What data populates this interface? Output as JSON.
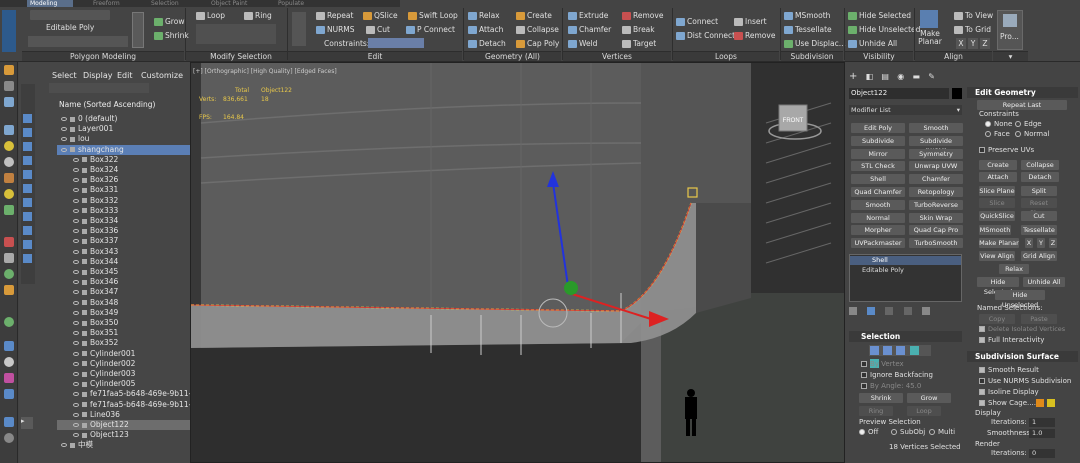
{
  "ribbon": {
    "tabs": [
      "Modeling",
      "Freeform",
      "Selection",
      "Object Paint",
      "Populate"
    ],
    "poly_label": "Editable Poly",
    "groups": [
      "Polygon Modeling",
      "Modify Selection",
      "Edit",
      "Geometry (All)",
      "Vertices",
      "Loops",
      "Subdivision",
      "Visibility",
      "Align"
    ],
    "modsel": [
      "Grow",
      "Shrink",
      "Loop",
      "Ring"
    ],
    "edit": [
      "Repeat",
      "QSlice",
      "Swift Loop",
      "NURMS",
      "Cut",
      "P Connect",
      "Constraints:"
    ],
    "geom": [
      "Relax",
      "Create",
      "Attach",
      "Collapse",
      "Detach",
      "Cap Poly"
    ],
    "verts": [
      "Extrude",
      "Remove",
      "Chamfer",
      "Break",
      "Weld",
      "Target"
    ],
    "loops": [
      "Connect",
      "Insert",
      "Dist Connect",
      "Remove"
    ],
    "subdiv": [
      "MSmooth",
      "Tessellate",
      "Use Displac..."
    ],
    "vis": [
      "Hide Selected",
      "Hide Unselected",
      "Unhide All"
    ],
    "align": [
      "Make Planar",
      "To View",
      "To Grid",
      "X",
      "Y",
      "Z"
    ],
    "pro": "Pro..."
  },
  "scene": {
    "menu": [
      "Select",
      "Display",
      "Edit",
      "Customize"
    ],
    "sort_label": "Name (Sorted Ascending)",
    "items": [
      "0 (default)",
      "Layer001",
      "lou",
      "shangchang",
      "Box322",
      "Box324",
      "Box326",
      "Box331",
      "Box332",
      "Box333",
      "Box334",
      "Box336",
      "Box337",
      "Box343",
      "Box344",
      "Box345",
      "Box346",
      "Box347",
      "Box348",
      "Box349",
      "Box350",
      "Box351",
      "Box352",
      "Cylinder001",
      "Cylinder002",
      "Cylinder003",
      "Cylinder005",
      "fe71faa5-b648-469e-9b11-f1",
      "fe71faa5-b648-469e-9b11-f1",
      "Line036",
      "Object122",
      "Object123",
      "中模"
    ]
  },
  "viewport": {
    "label": "[+] [Orthographic] [High Quality] [Edged Faces]",
    "stats_total": "Total",
    "stats_obj": "Object122",
    "verts_label": "Verts:",
    "verts_total": "836,661",
    "verts_obj": "18",
    "fps_label": "FPS:",
    "fps_val": "164.84",
    "viewcube": "FRONT"
  },
  "cmd": {
    "object_name": "Object122",
    "modifier_list": "Modifier List",
    "mod_buttons": [
      "Edit Poly",
      "Smooth",
      "Subdivide",
      "Subdivide (WSM)",
      "Mirror",
      "Symmetry",
      "STL Check",
      "Unwrap UVW",
      "Shell",
      "Chamfer",
      "Quad Chamfer",
      "Retopology",
      "Smooth",
      "TurboReverse",
      "Normal",
      "Skin Wrap",
      "Morpher",
      "Quad Cap Pro",
      "UVPackmaster",
      "TurboSmooth"
    ],
    "stack": [
      "Shell",
      "Editable Poly"
    ],
    "selection_title": "Selection",
    "by_vertex": "By Vertex",
    "ignore_backfacing": "Ignore Backfacing",
    "by_angle": "By Angle:",
    "by_angle_val": "45.0",
    "shrink": "Shrink",
    "grow": "Grow",
    "ring": "Ring",
    "loop": "Loop",
    "preview_sel": "Preview Selection",
    "preview_opts": [
      "Off",
      "SubObj",
      "Multi"
    ],
    "sel_count": "18 Vertices Selected",
    "edit_geom_title": "Edit Geometry",
    "repeat_last": "Repeat Last",
    "constraints": "Constraints",
    "constraint_opts": [
      "None",
      "Edge",
      "Face",
      "Normal"
    ],
    "preserve_uvs": "Preserve UVs",
    "eg_buttons": [
      "Create",
      "Collapse",
      "Attach",
      "Detach",
      "Slice Plane",
      "Split",
      "Slice",
      "Reset Plane",
      "QuickSlice",
      "Cut",
      "MSmooth",
      "Tessellate",
      "Make Planar",
      "X",
      "Y",
      "Z",
      "View Align",
      "Grid Align",
      "Relax",
      "Hide Selected",
      "Unhide All",
      "Hide Unselected"
    ],
    "named_sel": "Named Selections:",
    "copy": "Copy",
    "paste": "Paste",
    "delete_isolated": "Delete Isolated Vertices",
    "full_interactivity": "Full Interactivity",
    "subdiv_title": "Subdivision Surface",
    "smooth_result": "Smooth Result",
    "use_nurms": "Use NURMS Subdivision",
    "isoline": "Isoline Display",
    "show_cage": "Show Cage......",
    "display": "Display",
    "iterations": "Iterations:",
    "iter_val": "1",
    "smoothness": "Smoothness:",
    "smooth_val": "1.0",
    "render": "Render",
    "iter_render": "Iterations:",
    "iter_render_val": "0"
  }
}
